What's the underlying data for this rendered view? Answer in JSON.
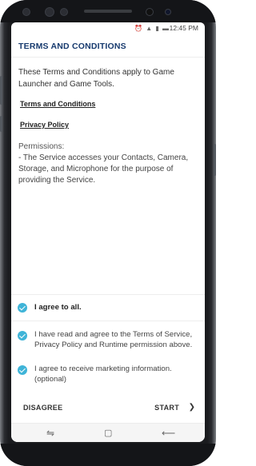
{
  "status_bar": {
    "time": "12:45 PM",
    "icons": [
      "alarm-icon",
      "wifi-icon",
      "signal-icon",
      "battery-icon"
    ]
  },
  "header": {
    "title": "TERMS AND CONDITIONS"
  },
  "body": {
    "intro": "These Terms and Conditions apply to Game Launcher and Game Tools.",
    "links": [
      "Terms and Conditions",
      "Privacy Policy"
    ],
    "permissions_heading": "Permissions:",
    "permissions_text": "- The Service accesses your Contacts, Camera, Storage, and Microphone for the purpose of providing the Service."
  },
  "agreements": {
    "all": {
      "label": "I agree to all.",
      "checked": true
    },
    "items": [
      {
        "label": "I have read and agree to the Terms of Service, Privacy Policy and Runtime permission above.",
        "checked": true
      },
      {
        "label": "I agree to receive marketing information. (optional)",
        "checked": true
      }
    ]
  },
  "footer": {
    "disagree_label": "DISAGREE",
    "start_label": "START"
  },
  "nav_bar": {
    "icons": [
      "recents-icon",
      "home-icon",
      "back-icon"
    ]
  },
  "colors": {
    "accent": "#3fb4d8",
    "title": "#173a6e"
  }
}
